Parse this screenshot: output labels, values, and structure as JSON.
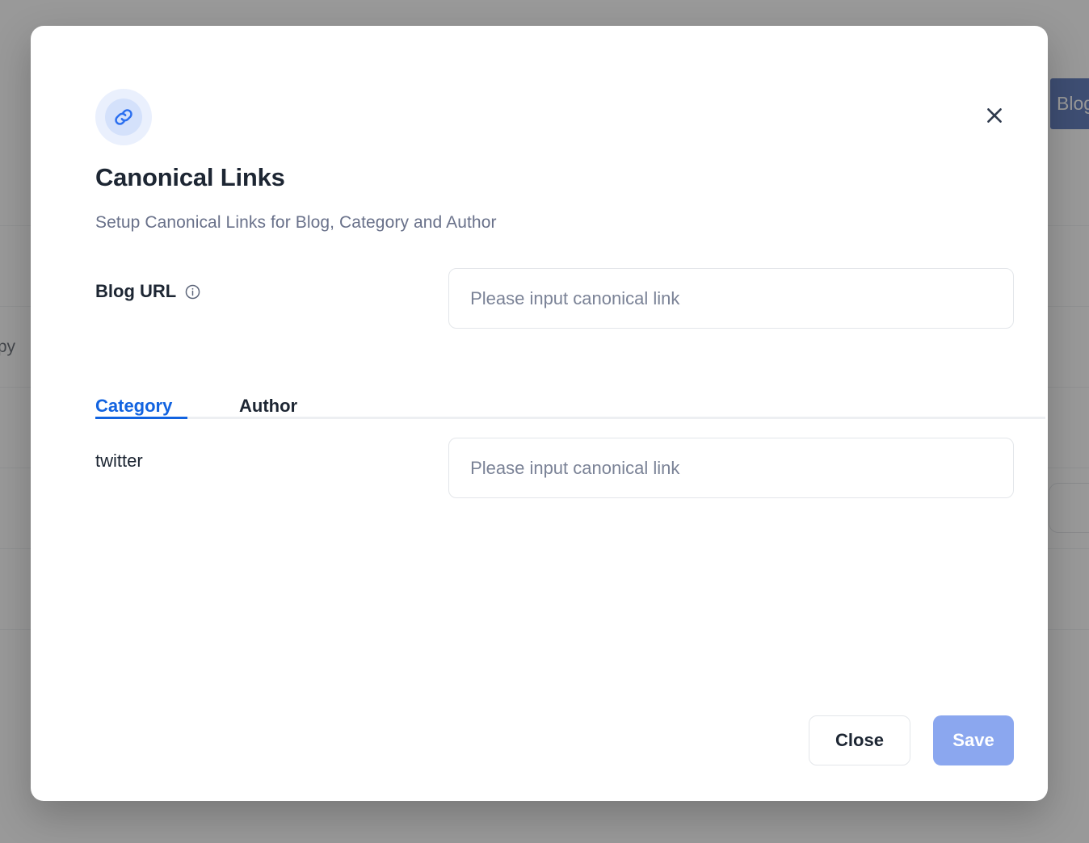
{
  "background": {
    "primary_button_label": "Blog Site",
    "rows": [
      {
        "cell": ""
      },
      {
        "cell": ""
      },
      {
        "cell": "Copy"
      },
      {
        "cell": ""
      },
      {
        "cell": ""
      },
      {
        "cell": ""
      }
    ]
  },
  "modal": {
    "icon": "link-icon",
    "close_icon": "close-icon",
    "title": "Canonical Links",
    "subtitle": "Setup Canonical Links for Blog, Category and Author",
    "blog_url": {
      "label": "Blog URL",
      "info_icon": "info-circle-icon",
      "value": "",
      "placeholder": "Please input canonical link"
    },
    "tabs": [
      {
        "label": "Category",
        "active": true
      },
      {
        "label": "Author",
        "active": false
      }
    ],
    "category_rows": [
      {
        "label": "twitter",
        "value": "",
        "placeholder": "Please input canonical link"
      }
    ],
    "footer": {
      "close_label": "Close",
      "save_label": "Save"
    },
    "colors": {
      "accent_blue": "#1263e0",
      "save_button": "#8ba7ef",
      "title_text": "#1d2633",
      "subtitle_text": "#69718a",
      "icon_bg_outer": "#eaf0fd",
      "icon_bg_inner": "#d4e1fb",
      "input_border": "#e3e6ea",
      "overlay": "rgba(90,90,90,0.62)"
    }
  }
}
